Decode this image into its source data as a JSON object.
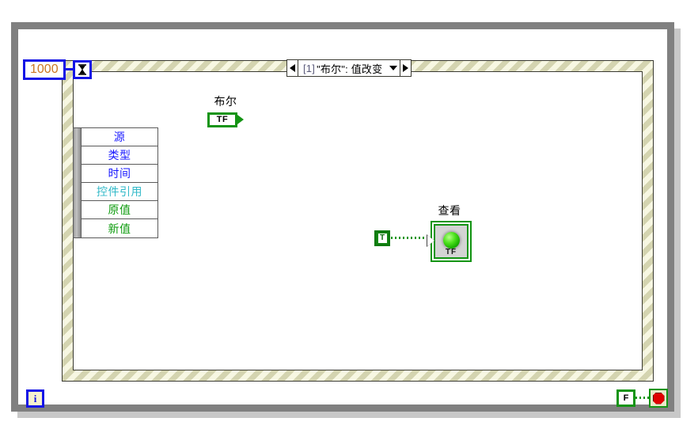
{
  "diagram": {
    "type": "labview-block-diagram",
    "loop": {
      "name": "while-loop"
    },
    "timeout_constant": {
      "value": "1000",
      "color": "#cc7722",
      "border": "#1414e6"
    },
    "timeout_terminal": {
      "icon": "hourglass-icon"
    },
    "event_structure": {
      "case_selector": {
        "index": "[1]",
        "label": "\"布尔\": 值改变",
        "left_arrow": "◀",
        "right_arrow": "▶",
        "chevron": "▾"
      },
      "data_node": {
        "rows": [
          {
            "label": "源",
            "color": "#1a1aff"
          },
          {
            "label": "类型",
            "color": "#1a1aff"
          },
          {
            "label": "时间",
            "color": "#1a1aff"
          },
          {
            "label": "控件引用",
            "color": "#32b9c8"
          },
          {
            "label": "原值",
            "color": "#0d9b0d"
          },
          {
            "label": "新值",
            "color": "#0d9b0d"
          }
        ]
      }
    },
    "boolean_terminal": {
      "label": "布尔",
      "value_text": "TF",
      "color": "#149414"
    },
    "true_constant": {
      "label": "T",
      "color": "#138a13"
    },
    "led_indicator": {
      "label": "查看",
      "value_text": "TF",
      "state": "on",
      "led_color": "#4ee21e"
    },
    "iteration_terminal": {
      "label": "i",
      "color": "#1414e6"
    },
    "false_constant": {
      "label": "F",
      "color": "#149414"
    },
    "stop_terminal": {
      "icon": "stop-octagon-icon",
      "color": "#e00000"
    }
  }
}
